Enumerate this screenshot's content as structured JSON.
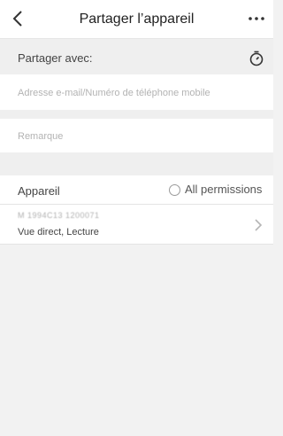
{
  "header": {
    "title": "Partager l’appareil",
    "back_icon": "back-chevron-icon",
    "more_icon": "more-dots-icon"
  },
  "share_section": {
    "label": "Partager avec:",
    "timer_icon": "timer-icon"
  },
  "fields": {
    "contact_placeholder": "Adresse e-mail/Numéro de téléphone mobile",
    "note_placeholder": "Remarque"
  },
  "device_section": {
    "label": "Appareil",
    "all_permissions_label": "All permissions",
    "all_permissions_checked": false
  },
  "device_item": {
    "id_text": "M 1994C13 1200071",
    "permissions_text": "Vue direct, Lecture",
    "chevron_icon": "chevron-right-icon"
  },
  "colors": {
    "background": "#f2f2f2",
    "section_grey": "#efefef",
    "surface": "#ffffff",
    "placeholder": "#b3b3b3"
  }
}
